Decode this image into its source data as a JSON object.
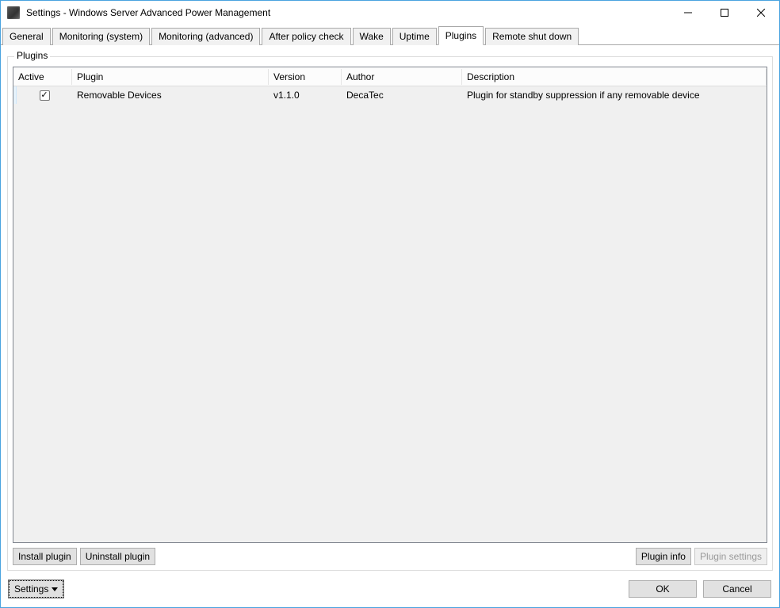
{
  "window": {
    "title": "Settings - Windows Server Advanced Power Management"
  },
  "tabs": [
    {
      "label": "General"
    },
    {
      "label": "Monitoring (system)"
    },
    {
      "label": "Monitoring (advanced)"
    },
    {
      "label": "After policy check"
    },
    {
      "label": "Wake"
    },
    {
      "label": "Uptime"
    },
    {
      "label": "Plugins",
      "active": true
    },
    {
      "label": "Remote shut down"
    }
  ],
  "group": {
    "label": "Plugins"
  },
  "columns": {
    "active": "Active",
    "plugin": "Plugin",
    "version": "Version",
    "author": "Author",
    "description": "Description"
  },
  "rows": [
    {
      "active": true,
      "plugin": "Removable Devices",
      "version": "v1.1.0",
      "author": "DecaTec",
      "description": "Plugin for standby suppression if any removable device"
    }
  ],
  "pluginButtons": {
    "install": "Install plugin",
    "uninstall": "Uninstall plugin",
    "info": "Plugin info",
    "settings": "Plugin settings"
  },
  "footer": {
    "settings": "Settings",
    "ok": "OK",
    "cancel": "Cancel"
  }
}
